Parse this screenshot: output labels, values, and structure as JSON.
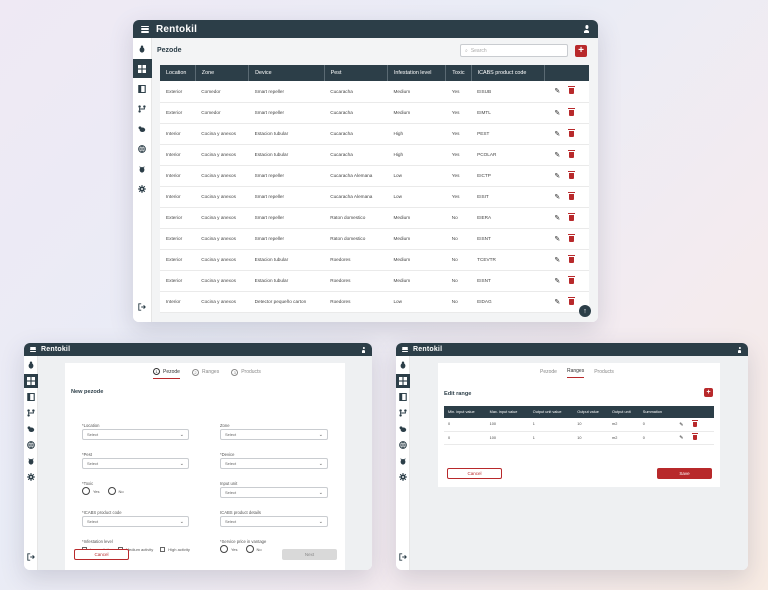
{
  "brand": "Rentokil",
  "pest_list": {
    "title": "Pezode",
    "search_placeholder": "Search",
    "add_label": "+",
    "columns": [
      "Location",
      "Zone",
      "Device",
      "Pest",
      "Infestation level",
      "Toxic",
      "ICABS product code"
    ],
    "rows": [
      [
        "Exterior",
        "Comedor",
        "Smart repeller",
        "Cucaracha",
        "Medium",
        "Yes",
        "EISUB"
      ],
      [
        "Exterior",
        "Comedor",
        "Smart repeller",
        "Cucaracha",
        "Medium",
        "Yes",
        "EIMTL"
      ],
      [
        "Interior",
        "Cocina y anexos",
        "Estacion tubular",
        "Cucaracha",
        "High",
        "Yes",
        "PEST"
      ],
      [
        "Interior",
        "Cocina y anexos",
        "Estacion tubular",
        "Cucaracha",
        "High",
        "Yes",
        "PCOLAR"
      ],
      [
        "Interior",
        "Cocina y anexos",
        "Smart repeller",
        "Cucaracha Alemana",
        "Low",
        "Yes",
        "EICTP"
      ],
      [
        "Interior",
        "Cocina y anexos",
        "Smart repeller",
        "Cucaracha Alemana",
        "Low",
        "Yes",
        "EISIT"
      ],
      [
        "Exterior",
        "Cocina y anexos",
        "Smart repeller",
        "Raton domestico",
        "Medium",
        "No",
        "EIERA"
      ],
      [
        "Exterior",
        "Cocina y anexos",
        "Smart repeller",
        "Raton domestico",
        "Medium",
        "No",
        "EISNT"
      ],
      [
        "Exterior",
        "Cocina y anexos",
        "Estacion tubular",
        "Roedores",
        "Medium",
        "No",
        "TCEVTR"
      ],
      [
        "Exterior",
        "Cocina y anexos",
        "Estacion tubular",
        "Roedores",
        "Medium",
        "No",
        "EISNT"
      ],
      [
        "Interior",
        "Cocina y anexos",
        "Detector pequeño carton",
        "Roedores",
        "Low",
        "No",
        "EIDAG"
      ]
    ],
    "edit_icon": "pencil-icon",
    "delete_icon": "trash-icon",
    "fab_icon": "arrow-up-icon"
  },
  "new_pezode": {
    "steps": [
      "Pezode",
      "Ranges",
      "Products"
    ],
    "step_numbers": [
      "1",
      "2",
      "3"
    ],
    "title": "New pezode",
    "fields": {
      "location": {
        "label": "*Location",
        "value": "Select"
      },
      "zone": {
        "label": "Zone",
        "value": "Select"
      },
      "pest": {
        "label": "*Pest",
        "value": "Select"
      },
      "device": {
        "label": "*Device",
        "value": "Select"
      },
      "toxic": {
        "label": "*Toxic",
        "options": [
          "Yes",
          "No"
        ]
      },
      "input_unit": {
        "label": "Input unit",
        "value": "Select"
      },
      "icabs_code": {
        "label": "*ICABS product code",
        "value": "Select"
      },
      "icabs_details": {
        "label": "ICABS product details",
        "value": "Select"
      },
      "infestation": {
        "label": "*Infestation level",
        "options": [
          "Low activity",
          "Medium activity",
          "High activity"
        ]
      },
      "service_price": {
        "label": "*Service price in vantage",
        "options": [
          "Yes",
          "No"
        ]
      }
    },
    "cancel_label": "Cancel",
    "next_label": "Next"
  },
  "edit_range": {
    "steps": [
      "Pezode",
      "Ranges",
      "Products"
    ],
    "title": "Edit range",
    "add_label": "+",
    "columns": [
      "Min. input value",
      "Max. input value",
      "Output unit value",
      "Output value",
      "Output unit",
      "Summation"
    ],
    "rows": [
      [
        "0",
        "100",
        "1",
        "10",
        "m2",
        "0"
      ],
      [
        "0",
        "100",
        "1",
        "10",
        "m2",
        "0"
      ]
    ],
    "cancel_label": "Cancel",
    "save_label": "Save"
  },
  "sidebar_icons": [
    "bug-icon",
    "dashboard-icon",
    "book-icon",
    "flow-icon",
    "rat-icon",
    "globe-icon",
    "beetle-icon",
    "gear-icon"
  ],
  "logout_icon": "logout-icon",
  "colors": {
    "topbar": "#2c3e48",
    "accent": "#b8292b"
  }
}
